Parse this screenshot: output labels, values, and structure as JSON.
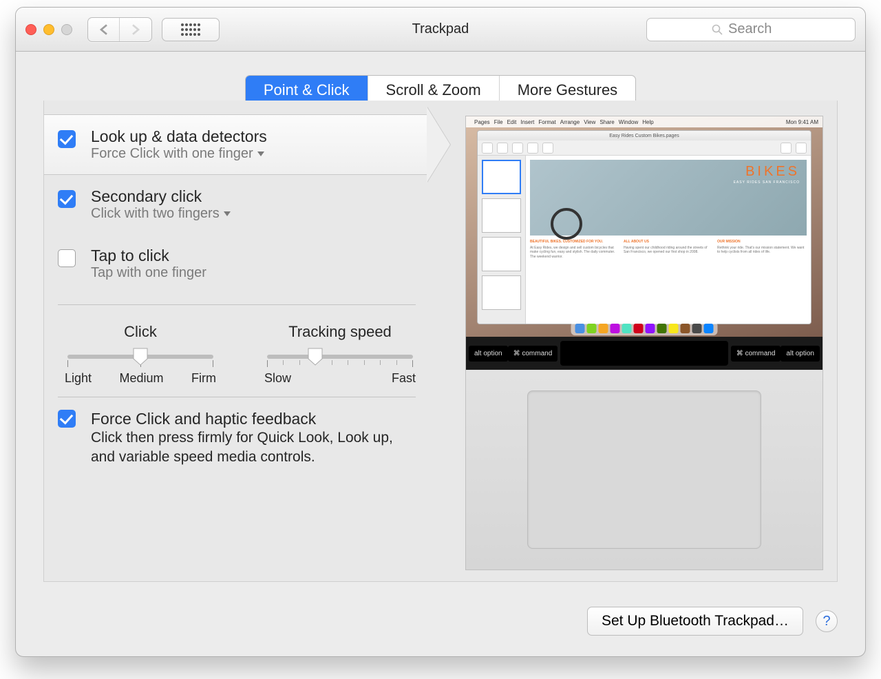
{
  "window": {
    "title": "Trackpad"
  },
  "toolbar": {
    "search_placeholder": "Search"
  },
  "tabs": [
    {
      "label": "Point & Click",
      "active": true
    },
    {
      "label": "Scroll & Zoom",
      "active": false
    },
    {
      "label": "More Gestures",
      "active": false
    }
  ],
  "options": {
    "lookup": {
      "title": "Look up & data detectors",
      "sub": "Force Click with one finger",
      "checked": true,
      "selected": true
    },
    "secondary": {
      "title": "Secondary click",
      "sub": "Click with two fingers",
      "checked": true
    },
    "tap": {
      "title": "Tap to click",
      "sub": "Tap with one finger",
      "checked": false
    }
  },
  "sliders": {
    "click": {
      "label": "Click",
      "min_label": "Light",
      "mid_label": "Medium",
      "max_label": "Firm",
      "ticks": 3,
      "value_index": 1
    },
    "tracking": {
      "label": "Tracking speed",
      "min_label": "Slow",
      "max_label": "Fast",
      "ticks": 10,
      "value_index": 3
    }
  },
  "force_click": {
    "title": "Force Click and haptic feedback",
    "desc": "Click then press firmly for Quick Look, Look up, and variable speed media controls.",
    "checked": true
  },
  "preview": {
    "menubar": [
      "Pages",
      "File",
      "Edit",
      "Insert",
      "Format",
      "Arrange",
      "View",
      "Share",
      "Window",
      "Help"
    ],
    "menubar_right": "Mon 9:41 AM",
    "doc_title_bar": "Easy Rides Custom Bikes.pages",
    "hero_text": "BIKES",
    "hero_sub": "EASY RIDES SAN FRANCISCO",
    "col_heads": [
      "BEAUTIFUL BIKES. CUSTOMIZED FOR YOU.",
      "ALL ABOUT US",
      "OUR MISSION"
    ],
    "keys_left": [
      "alt option",
      "⌘ command"
    ],
    "keys_right": [
      "⌘ command",
      "alt option"
    ]
  },
  "bottom": {
    "setup_label": "Set Up Bluetooth Trackpad…",
    "help_label": "?"
  },
  "colors": {
    "accent": "#2f7df6"
  }
}
